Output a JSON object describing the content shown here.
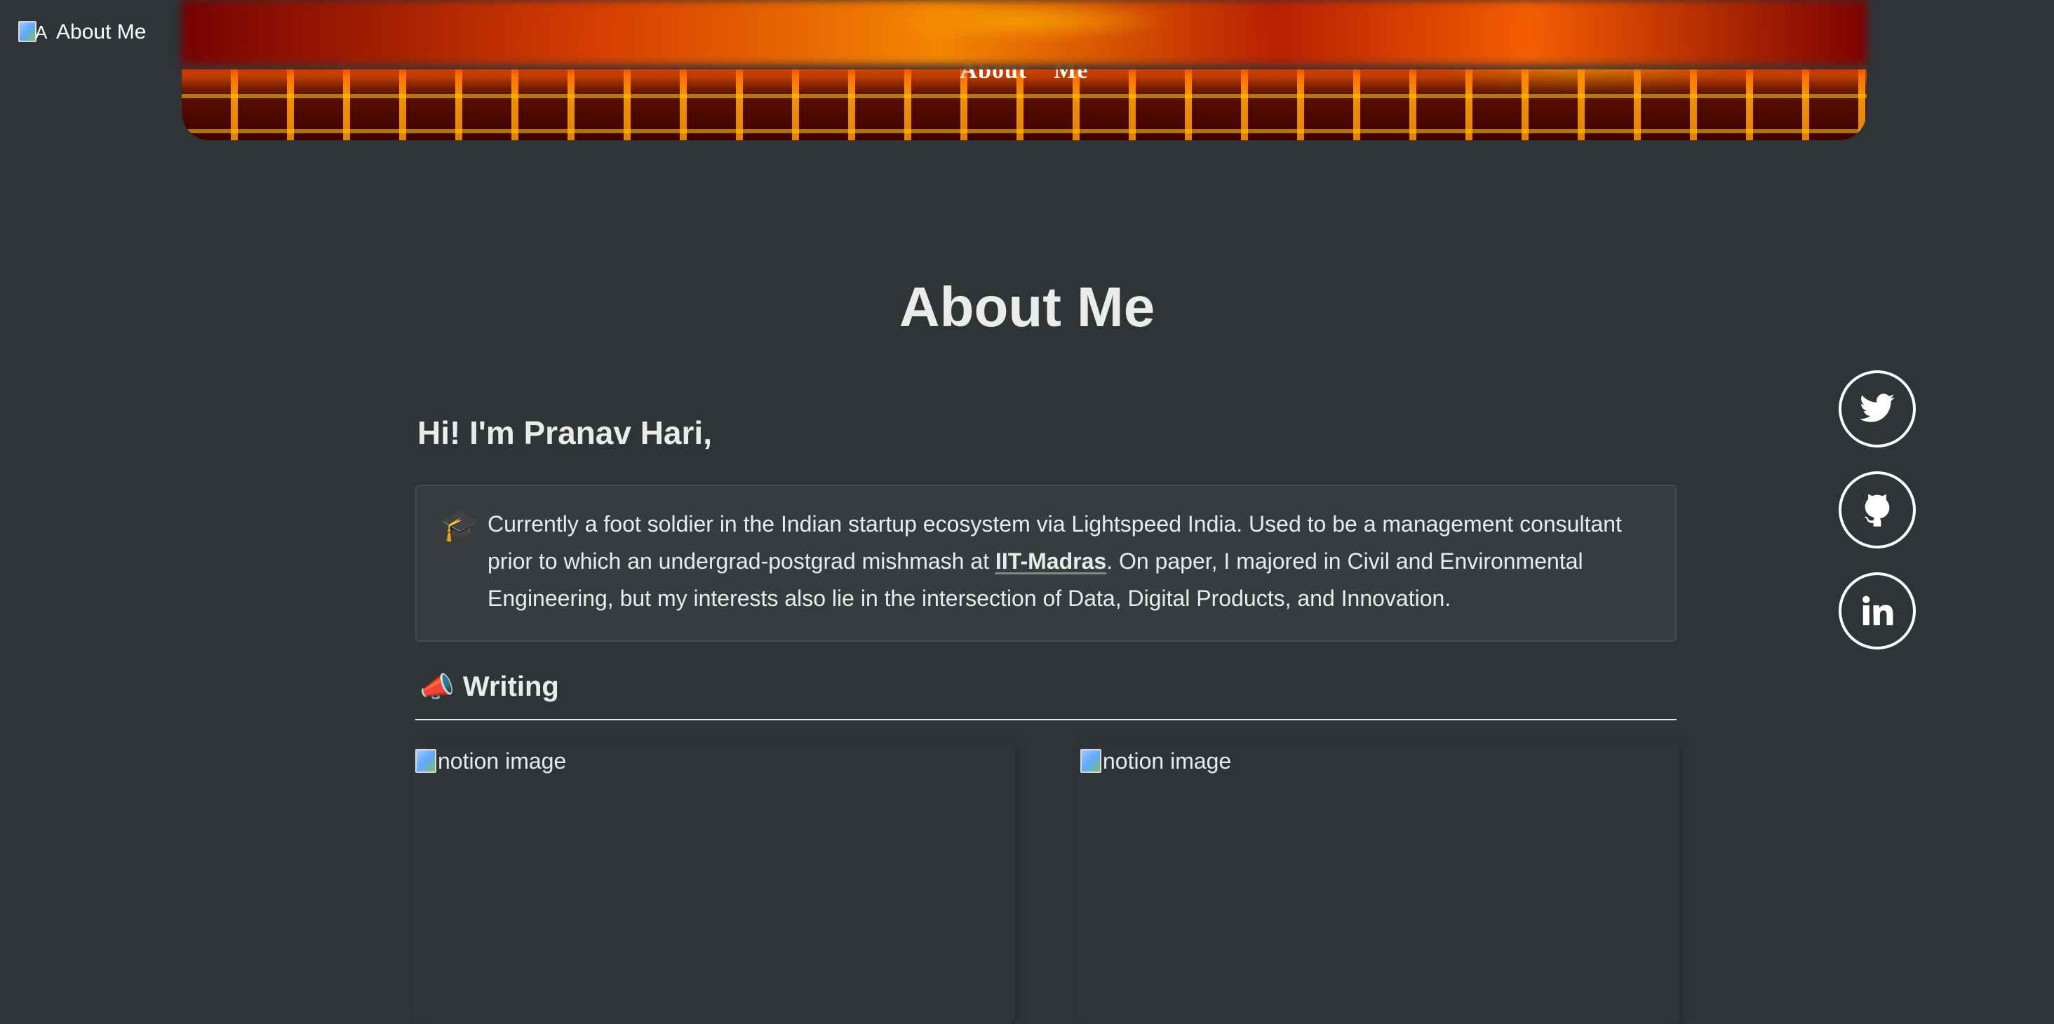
{
  "nav": {
    "brand_alt": "A",
    "title": "About Me"
  },
  "cover": {
    "overlay_alt": "About",
    "overlay_text": "Me"
  },
  "page": {
    "title": "About Me",
    "greeting": "Hi! I'm Pranav Hari,"
  },
  "callout": {
    "icon": "🎓",
    "text_before_link": "Currently a foot soldier in the Indian startup ecosystem via Lightspeed India. Used to be a management consultant prior to which an undergrad-postgrad mishmash at ",
    "link_text": "IIT-Madras",
    "text_after_link": ". On paper, I majored in Civil and Environmental Engineering, but my interests also lie in the intersection of Data, Digital Products, and Innovation."
  },
  "section": {
    "icon": "📣",
    "label": "Writing"
  },
  "cards": [
    {
      "image_alt": "notion image"
    },
    {
      "image_alt": "notion image"
    }
  ],
  "social": {
    "twitter_icon": "twitter-icon",
    "github_icon": "github-icon",
    "linkedin_icon": "linkedin-icon"
  }
}
